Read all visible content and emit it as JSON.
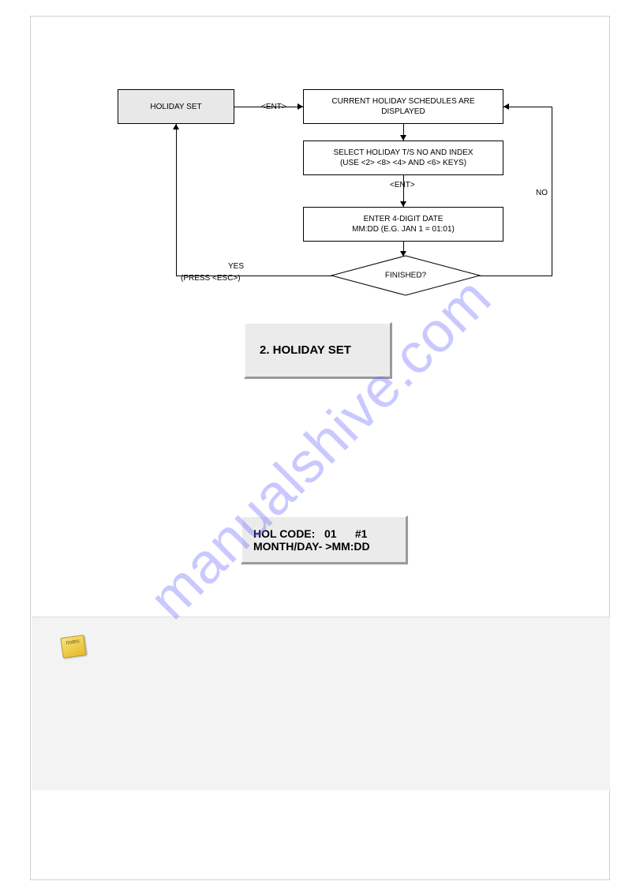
{
  "flow": {
    "start": "HOLIDAY SET",
    "box1_l1": "CURRENT HOLIDAY SCHEDULES ARE",
    "box1_l2": "DISPLAYED",
    "box2_l1": "SELECT HOLIDAY T/S NO AND INDEX",
    "box2_l2": "(USE <2> <8> <4> AND <6> KEYS)",
    "box3_l1": "ENTER 4-DIGIT DATE",
    "box3_l2": "MM:DD (E.G. JAN 1 = 01:01)",
    "decision": "FINISHED?",
    "ent": "<ENT>",
    "yes": "YES",
    "esc": "(PRESS <ESC>)",
    "no": "NO"
  },
  "panel": {
    "title": "2. HOLIDAY SET",
    "code_l1": "HOL CODE:   01      #1",
    "code_l2": "MONTH/DAY- >MM:DD"
  },
  "notes_icon": "notes",
  "watermark": "manualshive.com"
}
